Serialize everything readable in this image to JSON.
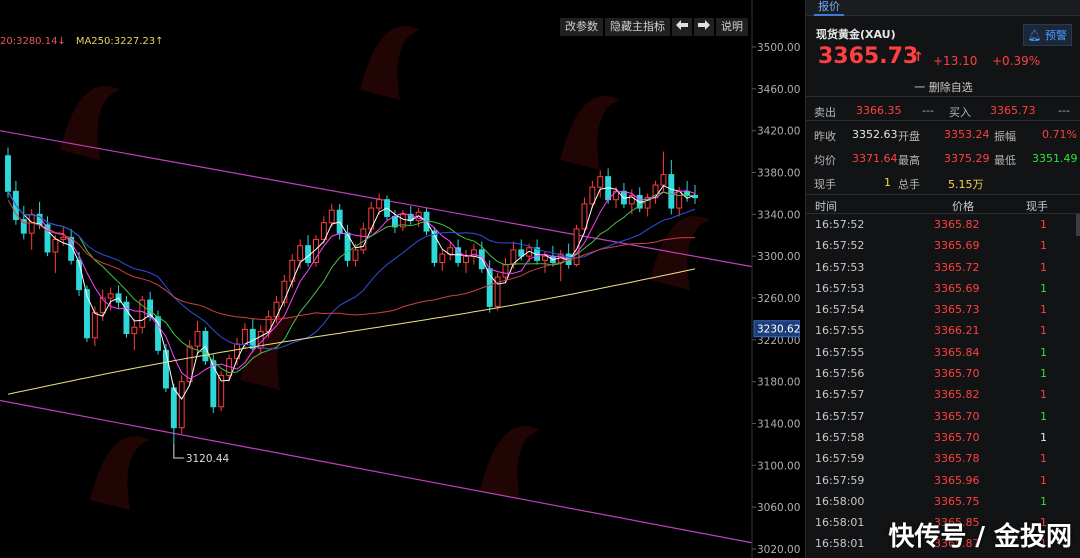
{
  "toolbar": {
    "params_label": "改参数",
    "hide_indicator_label": "隐藏主指标",
    "prev_icon": "left-arrow-icon",
    "next_icon": "right-arrow-icon",
    "help_label": "说明"
  },
  "ma_legend": {
    "ma_red": "20:3280.14↓",
    "ma250": "MA250:3227.23↑"
  },
  "chart_data": {
    "type": "candlestick",
    "y_ticks": [
      "3500.00",
      "3460.00",
      "3420.00",
      "3380.00",
      "3340.00",
      "3300.00",
      "3260.00",
      "3220.00",
      "3180.00",
      "3140.00",
      "3100.00",
      "3060.00",
      "3020.00"
    ],
    "ylim": [
      3020,
      3500
    ],
    "price_marker": "3230.62",
    "low_annotation": "3120.44",
    "colors": {
      "up": "#ff3c3c",
      "down": "#2ed8d8",
      "ma_white": "#ffffff",
      "ma_yellow": "#f0e08a",
      "ma_green": "#46c046",
      "ma_red": "#d04040",
      "ma_blue": "#3050e0",
      "ma_magenta": "#ff40ff",
      "channel": "#c040c0"
    },
    "candles": [
      [
        3396,
        3404,
        3356,
        3362
      ],
      [
        3362,
        3372,
        3330,
        3335
      ],
      [
        3335,
        3348,
        3316,
        3322
      ],
      [
        3322,
        3345,
        3306,
        3340
      ],
      [
        3340,
        3352,
        3326,
        3330
      ],
      [
        3330,
        3338,
        3300,
        3304
      ],
      [
        3304,
        3320,
        3284,
        3316
      ],
      [
        3316,
        3328,
        3310,
        3318
      ],
      [
        3318,
        3326,
        3292,
        3296
      ],
      [
        3296,
        3304,
        3262,
        3268
      ],
      [
        3268,
        3272,
        3218,
        3222
      ],
      [
        3222,
        3252,
        3214,
        3246
      ],
      [
        3246,
        3268,
        3238,
        3260
      ],
      [
        3260,
        3270,
        3248,
        3264
      ],
      [
        3264,
        3272,
        3250,
        3256
      ],
      [
        3256,
        3262,
        3222,
        3226
      ],
      [
        3226,
        3240,
        3210,
        3232
      ],
      [
        3232,
        3262,
        3226,
        3258
      ],
      [
        3258,
        3266,
        3238,
        3242
      ],
      [
        3242,
        3248,
        3206,
        3210
      ],
      [
        3210,
        3216,
        3170,
        3174
      ],
      [
        3174,
        3178,
        3120,
        3136
      ],
      [
        3136,
        3186,
        3130,
        3180
      ],
      [
        3180,
        3220,
        3176,
        3214
      ],
      [
        3214,
        3238,
        3206,
        3228
      ],
      [
        3228,
        3232,
        3196,
        3200
      ],
      [
        3200,
        3206,
        3150,
        3156
      ],
      [
        3156,
        3190,
        3152,
        3186
      ],
      [
        3186,
        3206,
        3180,
        3202
      ],
      [
        3202,
        3222,
        3196,
        3216
      ],
      [
        3216,
        3236,
        3212,
        3230
      ],
      [
        3230,
        3240,
        3208,
        3212
      ],
      [
        3212,
        3234,
        3206,
        3228
      ],
      [
        3228,
        3248,
        3222,
        3242
      ],
      [
        3242,
        3262,
        3236,
        3256
      ],
      [
        3256,
        3282,
        3252,
        3276
      ],
      [
        3276,
        3302,
        3270,
        3296
      ],
      [
        3296,
        3316,
        3288,
        3310
      ],
      [
        3310,
        3320,
        3290,
        3294
      ],
      [
        3294,
        3320,
        3290,
        3316
      ],
      [
        3316,
        3338,
        3312,
        3332
      ],
      [
        3332,
        3350,
        3328,
        3344
      ],
      [
        3344,
        3350,
        3316,
        3322
      ],
      [
        3322,
        3330,
        3290,
        3296
      ],
      [
        3296,
        3312,
        3290,
        3306
      ],
      [
        3306,
        3332,
        3302,
        3326
      ],
      [
        3326,
        3352,
        3322,
        3346
      ],
      [
        3346,
        3360,
        3340,
        3354
      ],
      [
        3354,
        3358,
        3334,
        3338
      ],
      [
        3338,
        3344,
        3322,
        3328
      ],
      [
        3328,
        3344,
        3324,
        3340
      ],
      [
        3340,
        3348,
        3330,
        3334
      ],
      [
        3334,
        3346,
        3328,
        3342
      ],
      [
        3342,
        3346,
        3320,
        3324
      ],
      [
        3324,
        3328,
        3290,
        3294
      ],
      [
        3294,
        3306,
        3286,
        3302
      ],
      [
        3302,
        3314,
        3296,
        3308
      ],
      [
        3308,
        3316,
        3290,
        3294
      ],
      [
        3294,
        3306,
        3284,
        3300
      ],
      [
        3300,
        3312,
        3292,
        3306
      ],
      [
        3306,
        3314,
        3284,
        3288
      ],
      [
        3288,
        3296,
        3246,
        3252
      ],
      [
        3252,
        3284,
        3248,
        3280
      ],
      [
        3280,
        3298,
        3274,
        3292
      ],
      [
        3292,
        3314,
        3288,
        3306
      ],
      [
        3306,
        3316,
        3296,
        3300
      ],
      [
        3300,
        3312,
        3294,
        3308
      ],
      [
        3308,
        3316,
        3292,
        3296
      ],
      [
        3296,
        3304,
        3284,
        3300
      ],
      [
        3300,
        3310,
        3290,
        3294
      ],
      [
        3294,
        3306,
        3276,
        3302
      ],
      [
        3302,
        3312,
        3288,
        3292
      ],
      [
        3292,
        3330,
        3290,
        3326
      ],
      [
        3326,
        3356,
        3322,
        3350
      ],
      [
        3350,
        3372,
        3346,
        3366
      ],
      [
        3366,
        3382,
        3356,
        3376
      ],
      [
        3376,
        3384,
        3350,
        3354
      ],
      [
        3354,
        3366,
        3346,
        3362
      ],
      [
        3362,
        3370,
        3346,
        3350
      ],
      [
        3350,
        3364,
        3340,
        3358
      ],
      [
        3358,
        3366,
        3342,
        3346
      ],
      [
        3346,
        3360,
        3338,
        3356
      ],
      [
        3356,
        3372,
        3350,
        3368
      ],
      [
        3368,
        3400,
        3362,
        3378
      ],
      [
        3378,
        3392,
        3340,
        3346
      ],
      [
        3346,
        3366,
        3338,
        3362
      ],
      [
        3362,
        3372,
        3352,
        3358
      ],
      [
        3358,
        3368,
        3350,
        3356
      ]
    ]
  },
  "panel": {
    "tab_label": "报价",
    "symbol_name": "现货黄金(XAU)",
    "alert_label": "预警",
    "alert_icon": "bell-icon",
    "last_price": "3365.73",
    "up_arrow": "↑",
    "change": "+13.10",
    "change_pct": "+0.39%",
    "remove_favorite": "一 删除自选",
    "sell_label": "卖出",
    "sell_price": "3366.35",
    "sell_vol": "---",
    "buy_label": "买入",
    "buy_price": "3365.73",
    "buy_vol": "---",
    "prev_close_label": "昨收",
    "prev_close": "3352.63",
    "open_label": "开盘",
    "open": "3353.24",
    "amplitude_label": "振幅",
    "amplitude": "0.71%",
    "avg_label": "均价",
    "avg": "3371.64",
    "high_label": "最高",
    "high": "3375.29",
    "low_label": "最低",
    "low": "3351.49",
    "cur_vol_label": "现手",
    "cur_vol": "1",
    "total_vol_label": "总手",
    "total_vol": "5.15万",
    "col_time": "时间",
    "col_price": "价格",
    "col_vol": "现手",
    "trades": [
      {
        "time": "16:57:52",
        "price": "3365.82",
        "vol": "1",
        "color": "red"
      },
      {
        "time": "16:57:52",
        "price": "3365.69",
        "vol": "1",
        "color": "red"
      },
      {
        "time": "16:57:53",
        "price": "3365.72",
        "vol": "1",
        "color": "red"
      },
      {
        "time": "16:57:53",
        "price": "3365.69",
        "vol": "1",
        "color": "green"
      },
      {
        "time": "16:57:54",
        "price": "3365.73",
        "vol": "1",
        "color": "red"
      },
      {
        "time": "16:57:55",
        "price": "3366.21",
        "vol": "1",
        "color": "red"
      },
      {
        "time": "16:57:55",
        "price": "3365.84",
        "vol": "1",
        "color": "green"
      },
      {
        "time": "16:57:56",
        "price": "3365.70",
        "vol": "1",
        "color": "green"
      },
      {
        "time": "16:57:57",
        "price": "3365.82",
        "vol": "1",
        "color": "red"
      },
      {
        "time": "16:57:57",
        "price": "3365.70",
        "vol": "1",
        "color": "green"
      },
      {
        "time": "16:57:58",
        "price": "3365.70",
        "vol": "1",
        "color": "white"
      },
      {
        "time": "16:57:59",
        "price": "3365.78",
        "vol": "1",
        "color": "red"
      },
      {
        "time": "16:57:59",
        "price": "3365.96",
        "vol": "1",
        "color": "red"
      },
      {
        "time": "16:58:00",
        "price": "3365.75",
        "vol": "1",
        "color": "green"
      },
      {
        "time": "16:58:01",
        "price": "3365.85",
        "vol": "1",
        "color": "red"
      },
      {
        "time": "16:58:01",
        "price": "3365.87",
        "vol": "1",
        "color": "red"
      }
    ]
  },
  "watermark": {
    "footer": "快传号 / 金投网"
  }
}
